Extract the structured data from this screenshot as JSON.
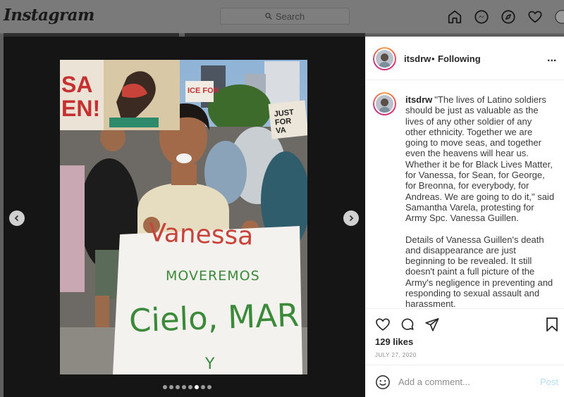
{
  "app": {
    "logo": "Instagram"
  },
  "search": {
    "placeholder": "Search"
  },
  "nav": [
    "home-icon",
    "messenger-icon",
    "explore-icon",
    "heart-icon",
    "profile-icon"
  ],
  "post": {
    "username": "itsdrw",
    "separator": "•",
    "follow_status": "Following",
    "more": "...",
    "caption_paragraphs": [
      "\"The lives of Latino soldiers should be just as valuable as the lives of any other soldier of any other ethnicity. Together we are going to move seas, and together even the heavens will hear us. Whether it be for Black Lives Matter, for Vanessa, for Sean, for George, for Breonna, for everybody, for Andreas. We are going to do it,\" said Samantha Varela, protesting for Army Spc. Vanessa Guillen.",
      "Details of Vanessa Guillen's death and disappearance are just beginning to be revealed. It still doesn't paint a full picture of the Army's negligence in preventing and responding to sexual assault and harassment."
    ],
    "likes": "129 likes",
    "date": "JULY 27, 2020",
    "comment_placeholder": "Add a comment...",
    "post_label": "Post"
  },
  "carousel": {
    "total": 8,
    "active_index": 5
  },
  "photo": {
    "sign_lines": [
      "Vanessa",
      "MOVEREMOS",
      "Cielo, MAR",
      "Y"
    ],
    "sa_sign": [
      "SA",
      "EN!"
    ],
    "just_sign": [
      "JUST",
      "FOR",
      "VA"
    ],
    "ice_sign": "ICE FOR"
  },
  "colors": {
    "link_blue": "#b2dffc",
    "sign_red": "#c8443b",
    "sign_green": "#3a8a3a"
  }
}
